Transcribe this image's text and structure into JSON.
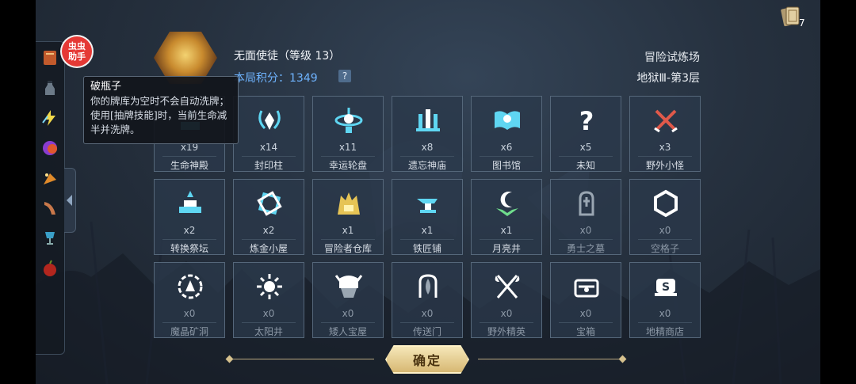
{
  "helper_badge": "虫虫\n助手",
  "tooltip": {
    "title": "破瓶子",
    "desc": "你的牌库为空时不会自动洗牌；使用[抽牌技能]时，当前生命减半并洗牌。"
  },
  "hero": {
    "name": "无面使徒（等级 13）",
    "score_label": "本局积分：",
    "score_value": "1349",
    "help": "?"
  },
  "mode": {
    "name": "冒险试炼场",
    "floor": "地狱Ⅲ-第3层"
  },
  "deck_count": "7",
  "confirm_label": "确定",
  "cells": [
    {
      "count": "x19",
      "label": "生命神殿",
      "icon": "temple-icon"
    },
    {
      "count": "x14",
      "label": "封印柱",
      "icon": "seal-pillar-icon"
    },
    {
      "count": "x11",
      "label": "幸运轮盘",
      "icon": "wheel-icon"
    },
    {
      "count": "x8",
      "label": "遗忘神庙",
      "icon": "ruins-icon"
    },
    {
      "count": "x6",
      "label": "图书馆",
      "icon": "book-icon"
    },
    {
      "count": "x5",
      "label": "未知",
      "icon": "question-icon"
    },
    {
      "count": "x3",
      "label": "野外小怪",
      "icon": "crossed-swords-icon"
    },
    {
      "count": "x2",
      "label": "转换祭坛",
      "icon": "altar-icon"
    },
    {
      "count": "x2",
      "label": "炼金小屋",
      "icon": "alchemy-icon"
    },
    {
      "count": "x1",
      "label": "冒险者仓库",
      "icon": "warehouse-icon"
    },
    {
      "count": "x1",
      "label": "铁匠铺",
      "icon": "anvil-icon"
    },
    {
      "count": "x1",
      "label": "月亮井",
      "icon": "moon-well-icon"
    },
    {
      "count": "x0",
      "label": "勇士之墓",
      "icon": "tomb-icon"
    },
    {
      "count": "x0",
      "label": "空格子",
      "icon": "hexagon-icon"
    },
    {
      "count": "x0",
      "label": "魔晶矿洞",
      "icon": "crystal-cave-icon"
    },
    {
      "count": "x0",
      "label": "太阳井",
      "icon": "sun-well-icon"
    },
    {
      "count": "x0",
      "label": "矮人宝屋",
      "icon": "dwarf-helmet-icon"
    },
    {
      "count": "x0",
      "label": "传送门",
      "icon": "portal-icon"
    },
    {
      "count": "x0",
      "label": "野外精英",
      "icon": "crossed-axes-icon"
    },
    {
      "count": "x0",
      "label": "宝箱",
      "icon": "chest-icon"
    },
    {
      "count": "x0",
      "label": "地精商店",
      "icon": "goblin-shop-icon"
    }
  ]
}
